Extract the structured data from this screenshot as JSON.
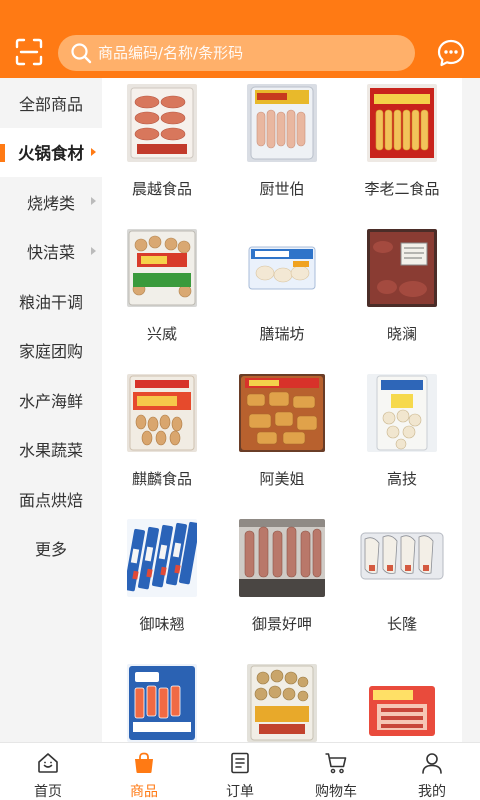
{
  "header": {
    "search_placeholder": "商品编码/名称/条形码",
    "accent_color": "#ff7a14",
    "icons": [
      "scan-icon",
      "search-icon",
      "chat-icon"
    ]
  },
  "sidebar": {
    "items": [
      {
        "label": "全部商品",
        "active": false,
        "has_arrow": false
      },
      {
        "label": "火锅食材",
        "active": true,
        "has_arrow": true
      },
      {
        "label": "烧烤类",
        "active": false,
        "has_arrow": true
      },
      {
        "label": "快洁菜",
        "active": false,
        "has_arrow": true
      },
      {
        "label": "粮油干调",
        "active": false,
        "has_arrow": false
      },
      {
        "label": "家庭团购",
        "active": false,
        "has_arrow": false
      },
      {
        "label": "水产海鲜",
        "active": false,
        "has_arrow": false
      },
      {
        "label": "水果蔬菜",
        "active": false,
        "has_arrow": false
      },
      {
        "label": "面点烘焙",
        "active": false,
        "has_arrow": false
      },
      {
        "label": "更多",
        "active": false,
        "has_arrow": false
      }
    ]
  },
  "brands": [
    {
      "name": "晨越食品"
    },
    {
      "name": "厨世伯"
    },
    {
      "name": "李老二食品"
    },
    {
      "name": "兴威"
    },
    {
      "name": "膳瑞坊"
    },
    {
      "name": "晓澜"
    },
    {
      "name": "麒麟食品"
    },
    {
      "name": "阿美姐"
    },
    {
      "name": "高技"
    },
    {
      "name": "御味翘"
    },
    {
      "name": "御景好呷"
    },
    {
      "name": "长隆"
    },
    {
      "name": ""
    },
    {
      "name": ""
    },
    {
      "name": ""
    }
  ],
  "tabbar": {
    "tabs": [
      {
        "label": "首页",
        "icon": "home-icon",
        "active": false
      },
      {
        "label": "商品",
        "icon": "shopping-bag-icon",
        "active": true
      },
      {
        "label": "订单",
        "icon": "order-list-icon",
        "active": false
      },
      {
        "label": "购物车",
        "icon": "cart-icon",
        "active": false
      },
      {
        "label": "我的",
        "icon": "profile-icon",
        "active": false
      }
    ]
  }
}
